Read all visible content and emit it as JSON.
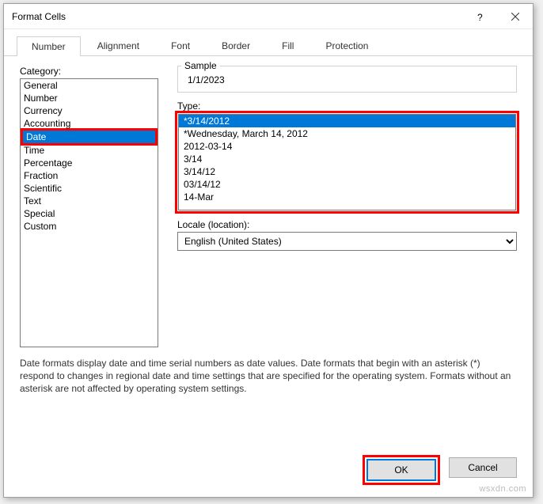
{
  "titlebar": {
    "title": "Format Cells"
  },
  "tabs": {
    "number": "Number",
    "alignment": "Alignment",
    "font": "Font",
    "border": "Border",
    "fill": "Fill",
    "protection": "Protection",
    "active": "number"
  },
  "category": {
    "label": "Category:",
    "items": [
      "General",
      "Number",
      "Currency",
      "Accounting",
      "Date",
      "Time",
      "Percentage",
      "Fraction",
      "Scientific",
      "Text",
      "Special",
      "Custom"
    ],
    "selected": "Date"
  },
  "sample": {
    "label": "Sample",
    "value": "1/1/2023"
  },
  "type": {
    "label": "Type:",
    "items": [
      "*3/14/2012",
      "*Wednesday, March 14, 2012",
      "2012-03-14",
      "3/14",
      "3/14/12",
      "03/14/12",
      "14-Mar"
    ],
    "selected": "*3/14/2012"
  },
  "locale": {
    "label": "Locale (location):",
    "value": "English (United States)"
  },
  "description": "Date formats display date and time serial numbers as date values.  Date formats that begin with an asterisk (*) respond to changes in regional date and time settings that are specified for the operating system. Formats without an asterisk are not affected by operating system settings.",
  "buttons": {
    "ok": "OK",
    "cancel": "Cancel"
  },
  "watermark": "wsxdn.com"
}
